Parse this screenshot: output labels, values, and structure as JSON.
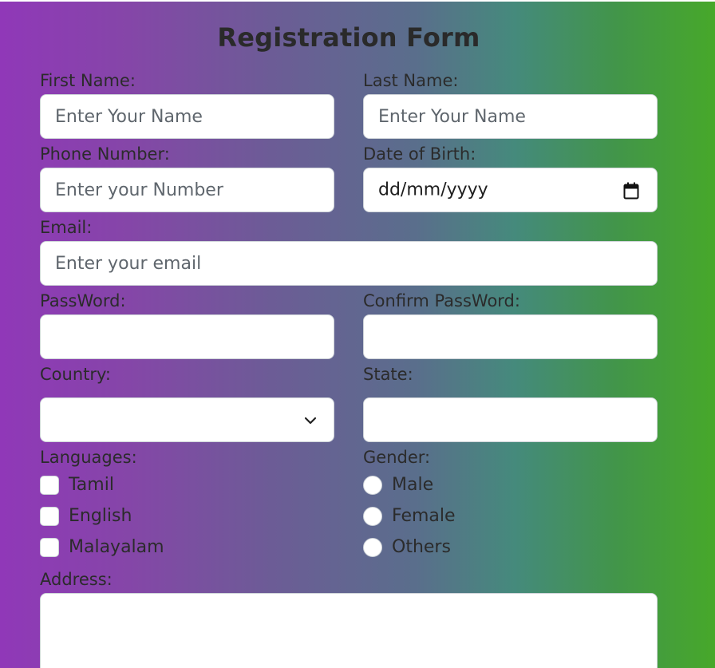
{
  "form": {
    "title": "Registration Form",
    "first_name": {
      "label": "First Name:",
      "placeholder": "Enter Your Name",
      "value": ""
    },
    "last_name": {
      "label": "Last Name:",
      "placeholder": "Enter Your Name",
      "value": ""
    },
    "phone": {
      "label": "Phone Number:",
      "placeholder": "Enter your Number",
      "value": ""
    },
    "dob": {
      "label": "Date of Birth:",
      "display": "dd/mm/yyyy"
    },
    "email": {
      "label": "Email:",
      "placeholder": "Enter your email",
      "value": ""
    },
    "password": {
      "label": "PassWord:",
      "value": ""
    },
    "confirm_password": {
      "label": "Confirm PassWord:",
      "value": ""
    },
    "country": {
      "label": "Country:",
      "selected": ""
    },
    "state": {
      "label": "State:",
      "value": ""
    },
    "languages": {
      "label": "Languages:",
      "options": [
        {
          "label": "Tamil",
          "checked": false
        },
        {
          "label": "English",
          "checked": false
        },
        {
          "label": "Malayalam",
          "checked": false
        }
      ]
    },
    "gender": {
      "label": "Gender:",
      "options": [
        {
          "label": "Male",
          "checked": false
        },
        {
          "label": "Female",
          "checked": false
        },
        {
          "label": "Others",
          "checked": false
        }
      ]
    },
    "address": {
      "label": "Address:",
      "value": ""
    }
  },
  "icons": {
    "date": "calendar-icon",
    "country": "chevron-down-icon"
  }
}
